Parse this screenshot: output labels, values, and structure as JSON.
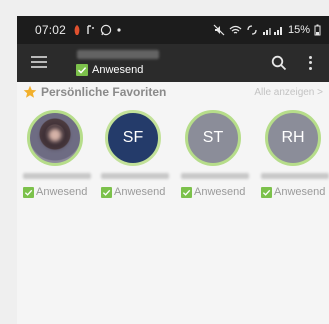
{
  "status_bar": {
    "time": "07:02",
    "battery": "15%"
  },
  "app_bar": {
    "status_label": "Anwesend"
  },
  "favorites": {
    "title": "Persönliche Favoriten",
    "see_all": "Alle anzeigen >",
    "items": [
      {
        "initials": "",
        "status_label": "Anwesend"
      },
      {
        "initials": "SF",
        "status_label": "Anwesend"
      },
      {
        "initials": "ST",
        "status_label": "Anwesend"
      },
      {
        "initials": "RH",
        "status_label": "Anwesend"
      }
    ]
  },
  "colors": {
    "accent_green": "#7cc14b",
    "ring_green": "#b6dd8a",
    "avatar_navy": "#243b6a",
    "avatar_gray": "#8b8d99",
    "app_bar": "#2b2b2b",
    "status_bar": "#1c1c1c",
    "star": "#f2b02c"
  },
  "icons": {
    "menu": "hamburger-menu-icon",
    "search": "search-icon",
    "more": "kebab-menu-icon",
    "favorite": "star-icon",
    "present": "checkmark-icon"
  }
}
